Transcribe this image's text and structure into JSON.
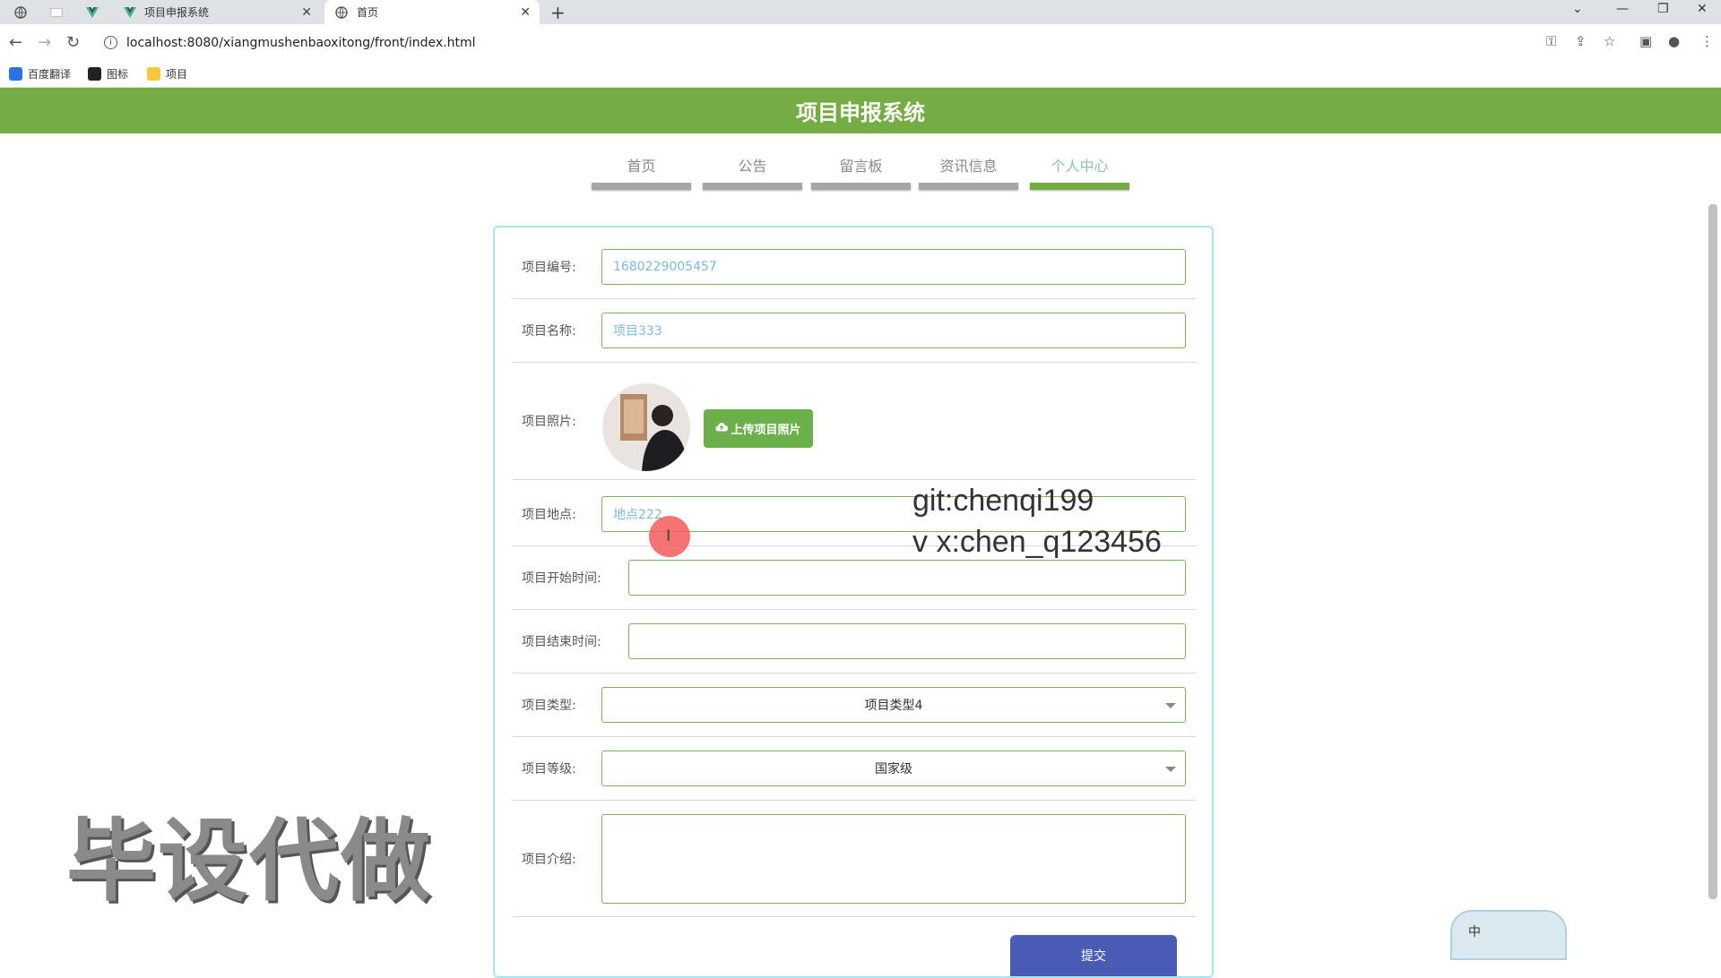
{
  "browser": {
    "tabs": [
      {
        "label": "",
        "icon": "globe-icon"
      },
      {
        "label": "",
        "icon": "blank-page-icon"
      },
      {
        "label": "",
        "icon": "vue-logo-icon"
      },
      {
        "label": "项目申报系统",
        "icon": "vue-logo-icon"
      },
      {
        "label": "首页",
        "icon": "globe-icon"
      }
    ],
    "new_tab": "+",
    "url": "localhost:8080/xiangmushenbaoxitong/front/index.html",
    "bookmarks": [
      {
        "label": "百度翻译",
        "icon": "translate-icon",
        "color": "#2b72e6"
      },
      {
        "label": "图标",
        "icon": "image-icon",
        "color": "#222222"
      },
      {
        "label": "项目",
        "icon": "folder-icon",
        "color": "#f5c842"
      }
    ]
  },
  "site": {
    "title": "项目申报系统",
    "nav": [
      {
        "label": "首页",
        "active": false
      },
      {
        "label": "公告",
        "active": false
      },
      {
        "label": "留言板",
        "active": false
      },
      {
        "label": "资讯信息",
        "active": false
      },
      {
        "label": "个人中心",
        "active": true
      }
    ],
    "accent_color": "#75ac43"
  },
  "form": {
    "fields": {
      "number": {
        "label": "项目编号:",
        "value": "1680229005457"
      },
      "name": {
        "label": "项目名称:",
        "value": "项目333"
      },
      "photo": {
        "label": "项目照片:",
        "upload_label": "上传项目照片"
      },
      "location": {
        "label": "项目地点:",
        "value": "地点222"
      },
      "start_time": {
        "label": "项目开始时间:",
        "value": ""
      },
      "end_time": {
        "label": "项目结束时间:",
        "value": ""
      },
      "type": {
        "label": "项目类型:",
        "value": "项目类型4"
      },
      "level": {
        "label": "项目等级:",
        "value": "国家级"
      },
      "intro": {
        "label": "项目介绍:",
        "value": ""
      }
    },
    "submit_label": "提交"
  },
  "overlay": {
    "line1": "git:chenqi199",
    "line2": "v x:chen_q123456",
    "big_watermark": "毕设代做",
    "ime_label": "中"
  }
}
